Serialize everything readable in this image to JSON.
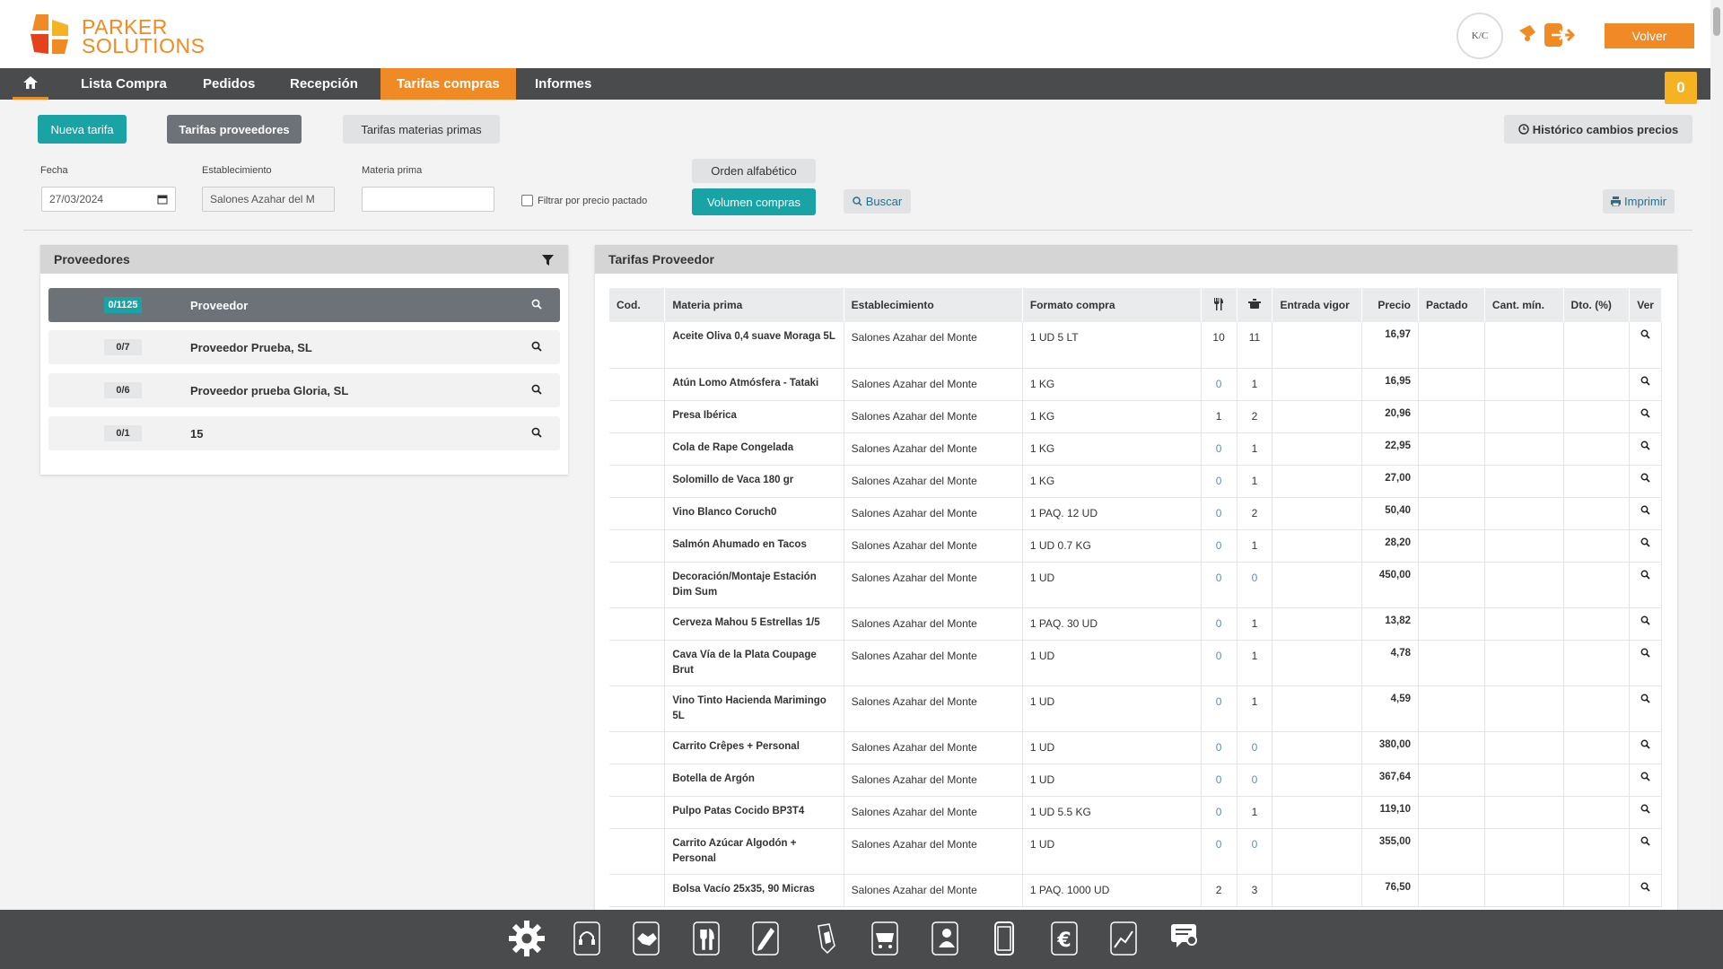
{
  "brand": {
    "line1": "PARKER",
    "line2": "SOLUTIONS",
    "color": "#f08a24"
  },
  "header": {
    "avatar_text": "K/C",
    "volver_label": "Volver",
    "cart_count": "0"
  },
  "nav": {
    "items": [
      {
        "label": "Lista Compra"
      },
      {
        "label": "Pedidos"
      },
      {
        "label": "Recepción"
      },
      {
        "label": "Tarifas compras",
        "active": true
      },
      {
        "label": "Informes"
      }
    ]
  },
  "toolbar": {
    "nueva_tarifa": "Nueva tarifa",
    "tarifas_proveedores": "Tarifas proveedores",
    "tarifas_materias": "Tarifas materias primas",
    "historico": "Histórico cambios precios",
    "orden_alfabetico": "Orden alfabético",
    "volumen_compras": "Volumen compras",
    "buscar": "Buscar",
    "imprimir": "Imprimir"
  },
  "filters": {
    "fecha_label": "Fecha",
    "fecha_value": "27/03/2024",
    "establecimiento_label": "Establecimiento",
    "establecimiento_value": "Salones Azahar del M",
    "materia_label": "Materia prima",
    "materia_value": "",
    "filtrar_label": "Filtrar por precio pactado"
  },
  "proveedores": {
    "title": "Proveedores",
    "rows": [
      {
        "count": "0/1125",
        "name": "Proveedor"
      },
      {
        "count": "0/7",
        "name": "Proveedor Prueba, SL"
      },
      {
        "count": "0/6",
        "name": "Proveedor prueba Gloria, SL"
      },
      {
        "count": "0/1",
        "name": "15"
      }
    ]
  },
  "tarifas": {
    "title": "Tarifas Proveedor",
    "headers": {
      "cod": "Cod.",
      "materia": "Materia prima",
      "establecimiento": "Establecimiento",
      "formato": "Formato compra",
      "entrada": "Entrada vigor",
      "precio": "Precio",
      "pactado": "Pactado",
      "cant": "Cant. mín.",
      "dto": "Dto. (%)",
      "ver": "Ver"
    },
    "rows": [
      {
        "cod": "",
        "materia": "Aceite Oliva 0,4 suave Moraga 5L",
        "est": "Salones Azahar del Monte",
        "fmt": "1 UD 5 LT",
        "a": "10",
        "b": "11",
        "precio": "16,97",
        "tall": true
      },
      {
        "cod": "",
        "materia": "Atún Lomo Atmósfera - Tataki",
        "est": "Salones Azahar del Monte",
        "fmt": "1 KG",
        "a": "0",
        "b": "1",
        "precio": "16,95"
      },
      {
        "cod": "",
        "materia": "Presa Ibérica",
        "est": "Salones Azahar del Monte",
        "fmt": "1 KG",
        "a": "1",
        "b": "2",
        "precio": "20,96"
      },
      {
        "cod": "",
        "materia": "Cola de Rape Congelada",
        "est": "Salones Azahar del Monte",
        "fmt": "1 KG",
        "a": "0",
        "b": "1",
        "precio": "22,95"
      },
      {
        "cod": "",
        "materia": "Solomillo de Vaca 180 gr",
        "est": "Salones Azahar del Monte",
        "fmt": "1 KG",
        "a": "0",
        "b": "1",
        "precio": "27,00"
      },
      {
        "cod": "",
        "materia": "Vino Blanco Coruch0",
        "est": "Salones Azahar del Monte",
        "fmt": "1 PAQ. 12 UD",
        "a": "0",
        "b": "2",
        "precio": "50,40"
      },
      {
        "cod": "",
        "materia": "Salmón Ahumado en Tacos",
        "est": "Salones Azahar del Monte",
        "fmt": "1 UD 0.7 KG",
        "a": "0",
        "b": "1",
        "precio": "28,20"
      },
      {
        "cod": "",
        "materia": "Decoración/Montaje Estación Dim Sum",
        "est": "Salones Azahar del Monte",
        "fmt": "1 UD",
        "a": "0",
        "b": "0",
        "precio": "450,00",
        "tall": true
      },
      {
        "cod": "",
        "materia": "Cerveza Mahou 5 Estrellas 1/5",
        "est": "Salones Azahar del Monte",
        "fmt": "1 PAQ. 30 UD",
        "a": "0",
        "b": "1",
        "precio": "13,82"
      },
      {
        "cod": "",
        "materia": "Cava Vía de la Plata Coupage Brut",
        "est": "Salones Azahar del Monte",
        "fmt": "1 UD",
        "a": "0",
        "b": "1",
        "precio": "4,78",
        "tall": true
      },
      {
        "cod": "",
        "materia": "Vino Tinto Hacienda Marimingo 5L",
        "est": "Salones Azahar del Monte",
        "fmt": "1 UD",
        "a": "0",
        "b": "1",
        "precio": "4,59",
        "tall": true
      },
      {
        "cod": "",
        "materia": "Carrito Crêpes + Personal",
        "est": "Salones Azahar del Monte",
        "fmt": "1 UD",
        "a": "0",
        "b": "0",
        "precio": "380,00"
      },
      {
        "cod": "",
        "materia": "Botella de Argón",
        "est": "Salones Azahar del Monte",
        "fmt": "1 UD",
        "a": "0",
        "b": "0",
        "precio": "367,64"
      },
      {
        "cod": "",
        "materia": "Pulpo Patas Cocido BP3T4",
        "est": "Salones Azahar del Monte",
        "fmt": "1 UD 5.5 KG",
        "a": "0",
        "b": "1",
        "precio": "119,10"
      },
      {
        "cod": "",
        "materia": "Carrito Azúcar Algodón + Personal",
        "est": "Salones Azahar del Monte",
        "fmt": "1 UD",
        "a": "0",
        "b": "0",
        "precio": "355,00",
        "tall": true
      },
      {
        "cod": "",
        "materia": "Bolsa Vacío 25x35, 90 Micras",
        "est": "Salones Azahar del Monte",
        "fmt": "1 PAQ. 1000 UD",
        "a": "2",
        "b": "3",
        "precio": "76,50"
      }
    ]
  },
  "dock": {
    "icons": [
      "gear-icon",
      "headset-icon",
      "handshake-icon",
      "cutlery-icon",
      "pencil-icon",
      "marker-icon",
      "cart-list-icon",
      "contacts-icon",
      "tablet-icon",
      "euro-icon",
      "chart-icon",
      "message-icon"
    ]
  }
}
